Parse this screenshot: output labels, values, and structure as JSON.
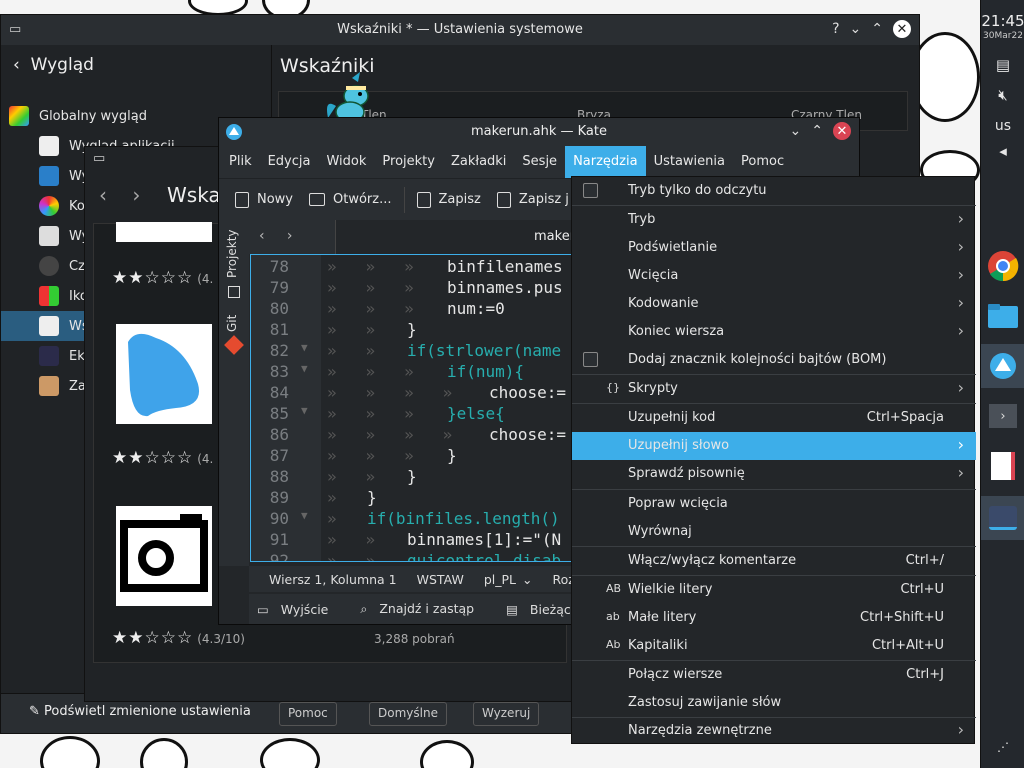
{
  "panel": {
    "time": "21:45",
    "date": "30Mar22",
    "keyboard_layout": "us"
  },
  "settings": {
    "title": "Wskaźniki * — Ustawienia systemowe",
    "back_label": "Wygląd",
    "heading": "Wskaźniki",
    "sidebar_items": [
      {
        "label": "Globalny wygląd"
      },
      {
        "label": "Wygląd aplikacji"
      },
      {
        "label": "Wy"
      },
      {
        "label": "Ko"
      },
      {
        "label": "Wy"
      },
      {
        "label": "Czc"
      },
      {
        "label": "Iko"
      },
      {
        "label": "Ws"
      },
      {
        "label": "Ekr"
      },
      {
        "label": "Zar"
      }
    ],
    "col_headers": [
      "Tlen",
      "Bryza",
      "Czarny Tlen"
    ],
    "highlight_label": "Podświetl zmienione ustawienia",
    "buttons": [
      "Pomoc",
      "Domyślne",
      "Wyzeruj"
    ]
  },
  "ghns": {
    "heading": "Wska",
    "ratings": [
      "(4.",
      "(4.",
      "(4.3/10)"
    ],
    "downloads": "3,288 pobrań"
  },
  "kate": {
    "title": "makerun.ahk — Kate",
    "menu": [
      "Plik",
      "Edycja",
      "Widok",
      "Projekty",
      "Zakładki",
      "Sesje",
      "Narzędzia",
      "Ustawienia",
      "Pomoc"
    ],
    "toolbar": [
      "Nowy",
      "Otwórz...",
      "Zapisz",
      "Zapisz j"
    ],
    "side_tabs": [
      "Projekty",
      "Git"
    ],
    "tab_name": "makerun.ahk",
    "status": {
      "position": "Wiersz 1, Kolumna 1",
      "mode": "WSTAW",
      "lang": "pl_PL",
      "extra": "Rozm"
    },
    "bottom": [
      "Wyjście",
      "Znajdź i zastąp",
      "Bieżący projekt"
    ]
  },
  "code_lines": [
    {
      "n": "78",
      "t": "binfilenames"
    },
    {
      "n": "79",
      "t": "binnames.pus"
    },
    {
      "n": "80",
      "t": "num:=0"
    },
    {
      "n": "81",
      "t": "}"
    },
    {
      "n": "82",
      "t": "if(strlower(name"
    },
    {
      "n": "83",
      "t": "if(num){"
    },
    {
      "n": "84",
      "t": "choose:="
    },
    {
      "n": "85",
      "t": "}else{"
    },
    {
      "n": "86",
      "t": "choose:="
    },
    {
      "n": "87",
      "t": "}"
    },
    {
      "n": "88",
      "t": "}"
    },
    {
      "n": "89",
      "t": "}"
    },
    {
      "n": "90",
      "t": "if(binfiles.length()"
    },
    {
      "n": "91",
      "t": "binnames[1]:=\"(N"
    },
    {
      "n": "92",
      "t": "guicontrol,disab"
    }
  ],
  "dropdown": [
    {
      "label": "Tryb tylko do odczytu",
      "checkbox": true
    },
    {
      "label": "Tryb",
      "submenu": true
    },
    {
      "label": "Podświetlanie",
      "submenu": true
    },
    {
      "label": "Wcięcia",
      "submenu": true
    },
    {
      "label": "Kodowanie",
      "submenu": true
    },
    {
      "label": "Koniec wiersza",
      "submenu": true
    },
    {
      "label": "Dodaj znacznik kolejności bajtów (BOM)",
      "checkbox": true
    },
    {
      "label": "Skrypty",
      "submenu": true,
      "icon": "{}"
    },
    {
      "label": "Uzupełnij kod",
      "shortcut": "Ctrl+Spacja"
    },
    {
      "label": "Uzupełnij słowo",
      "submenu": true,
      "highlighted": true
    },
    {
      "label": "Sprawdź pisownię",
      "submenu": true
    },
    {
      "label": "Popraw wcięcia"
    },
    {
      "label": "Wyrównaj"
    },
    {
      "label": "Włącz/wyłącz komentarze",
      "shortcut": "Ctrl+/"
    },
    {
      "label": "Wielkie litery",
      "shortcut": "Ctrl+U",
      "icon": "AB"
    },
    {
      "label": "Małe litery",
      "shortcut": "Ctrl+Shift+U",
      "icon": "ab"
    },
    {
      "label": "Kapitaliki",
      "shortcut": "Ctrl+Alt+U",
      "icon": "Ab"
    },
    {
      "label": "Połącz wiersze",
      "shortcut": "Ctrl+J"
    },
    {
      "label": "Zastosuj zawijanie słów"
    },
    {
      "label": "Narzędzia zewnętrzne",
      "submenu": true
    }
  ]
}
